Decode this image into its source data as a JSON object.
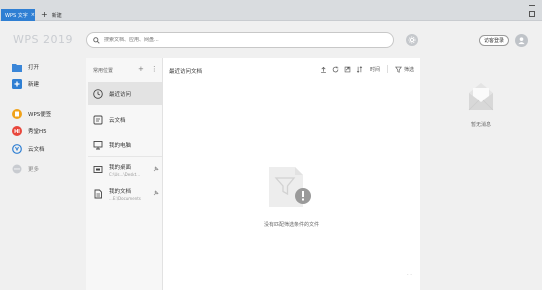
{
  "titlebar": {
    "active_tab": "WPS 文字",
    "tab_close": "×",
    "new_tab_label": "新建",
    "new_tab_plus": "+"
  },
  "header": {
    "logo": "WPS 2019",
    "search_placeholder": "搜索文档、应用、网盘...",
    "login_label": "访客登录"
  },
  "leftnav": {
    "items": [
      {
        "label": "打开",
        "icon": "folder-icon"
      },
      {
        "label": "新建",
        "icon": "new-icon"
      },
      {
        "label": "WPS便签",
        "icon": "note-icon"
      },
      {
        "label": "秀堂H5",
        "icon": "h5-icon"
      },
      {
        "label": "云文档",
        "icon": "cloud-doc-icon"
      },
      {
        "label": "更多",
        "icon": "more-icon"
      }
    ]
  },
  "locations": {
    "header": "常用位置",
    "items": [
      {
        "label": "最近访问",
        "sub": "",
        "icon": "clock-icon"
      },
      {
        "label": "云文档",
        "sub": "",
        "icon": "cloud-icon"
      },
      {
        "label": "我的电脑",
        "sub": "",
        "icon": "computer-icon"
      },
      {
        "label": "我的桌面",
        "sub": "C:\\Us...\\Deskt...",
        "icon": "desktop-icon"
      },
      {
        "label": "我的文档",
        "sub": "...E:\\Documents",
        "icon": "documents-icon"
      }
    ]
  },
  "main": {
    "title": "最近访问文档",
    "time_label": "时间",
    "filter_label": "筛选",
    "empty_text": "没有匹配筛选条件的文件",
    "corner": "- -"
  },
  "rightpanel": {
    "message": "暂无消息"
  },
  "colors": {
    "tab_active": "#2f7fd3",
    "new_button": "#2f7fd3",
    "wps_note": "#e8463b",
    "xiutang": "#e8463b",
    "cloud_doc": "#2f7fd3"
  }
}
